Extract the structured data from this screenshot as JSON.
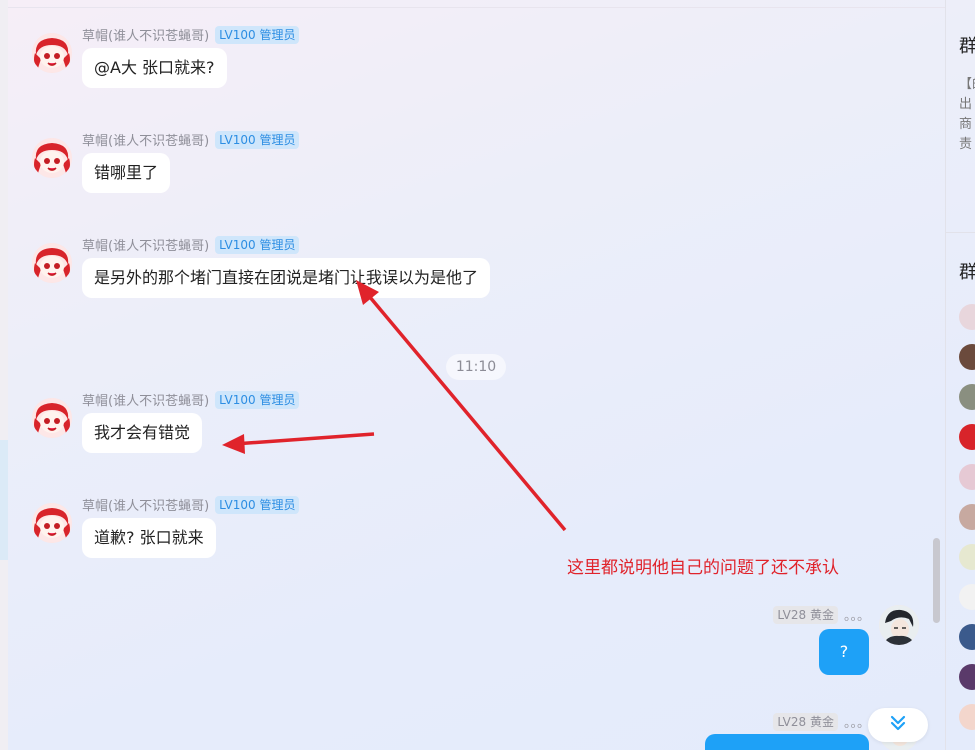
{
  "left_messages": [
    {
      "nick": "草帽(谁人不识苍蝇哥)",
      "badge": "LV100 管理员",
      "text": "@A大 张口就来?"
    },
    {
      "nick": "草帽(谁人不识苍蝇哥)",
      "badge": "LV100 管理员",
      "text": "错哪里了"
    },
    {
      "nick": "草帽(谁人不识苍蝇哥)",
      "badge": "LV100 管理员",
      "text": "是另外的那个堵门直接在团说是堵门让我误以为是他了"
    },
    {
      "nick": "草帽(谁人不识苍蝇哥)",
      "badge": "LV100 管理员",
      "text": "我才会有错觉"
    },
    {
      "nick": "草帽(谁人不识苍蝇哥)",
      "badge": "LV100 管理员",
      "text": "道歉? 张口就来"
    }
  ],
  "time_divider": "11:10",
  "right_messages": [
    {
      "badge": "LV28 黄金",
      "nick": "。。。",
      "text": "?"
    },
    {
      "badge": "LV28 黄金",
      "nick": "。。。",
      "text": ""
    }
  ],
  "annotation": {
    "text": "这里都说明他自己的问题了还不承认",
    "color": "#e0232b"
  },
  "sidebar": {
    "title_1": "群",
    "notice_chars": "【的出商责",
    "title_2": "群"
  },
  "icons": {
    "scroll_down": "double-chevron-down-icon"
  },
  "colors": {
    "accent_blue": "#1ea1f7",
    "badge_admin": "#2d8ee3",
    "annotation_red": "#e0232b"
  }
}
